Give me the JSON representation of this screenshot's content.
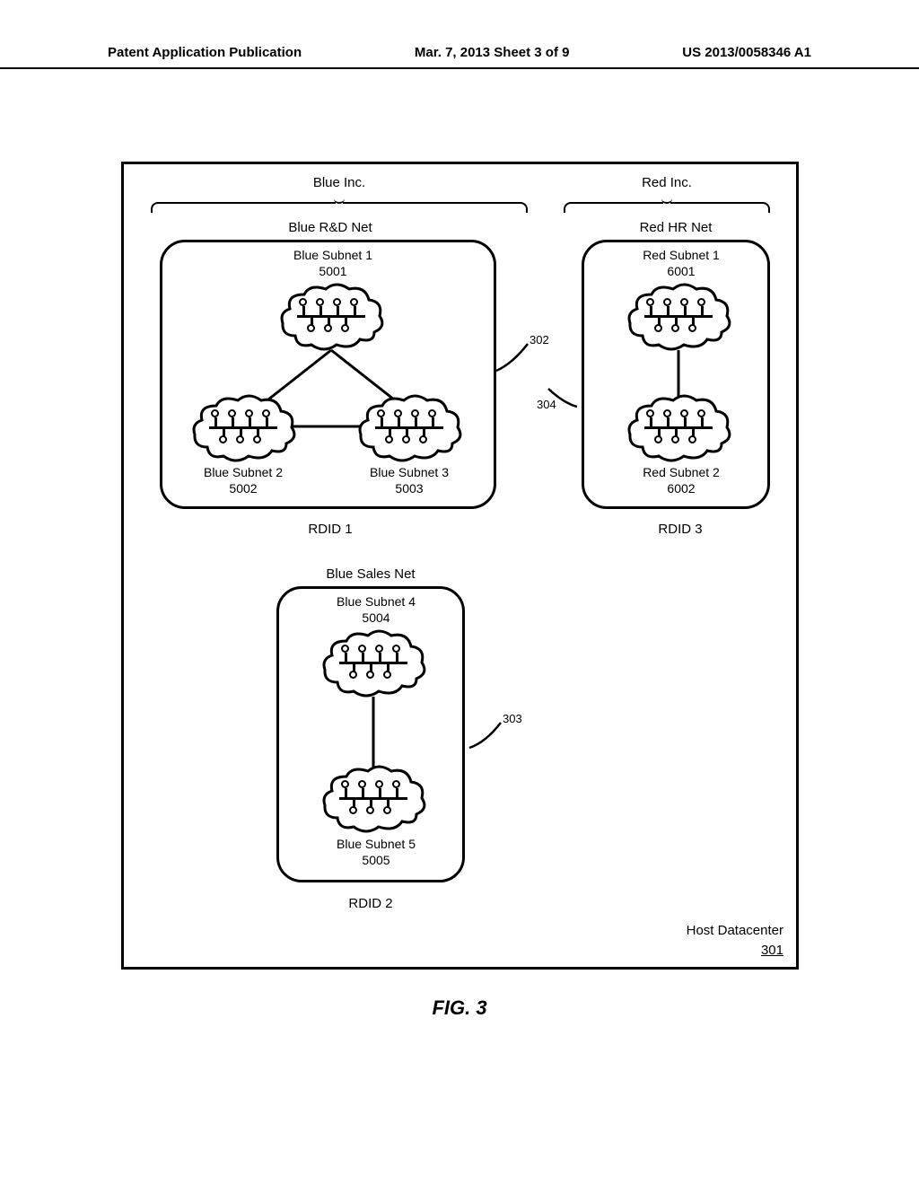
{
  "header": {
    "left": "Patent Application Publication",
    "center": "Mar. 7, 2013  Sheet 3 of 9",
    "right": "US 2013/0058346 A1"
  },
  "figure_caption": "FIG.  3",
  "companies": {
    "blue": "Blue Inc.",
    "red": "Red Inc."
  },
  "networks": {
    "blue_rnd": {
      "title": "Blue R&D Net",
      "rdid": "RDID 1",
      "subnets": {
        "s1": {
          "name": "Blue Subnet 1",
          "id": "5001"
        },
        "s2": {
          "name": "Blue Subnet 2",
          "id": "5002"
        },
        "s3": {
          "name": "Blue Subnet 3",
          "id": "5003"
        }
      }
    },
    "blue_sales": {
      "title": "Blue Sales Net",
      "rdid": "RDID 2",
      "subnets": {
        "s4": {
          "name": "Blue Subnet 4",
          "id": "5004"
        },
        "s5": {
          "name": "Blue Subnet 5",
          "id": "5005"
        }
      }
    },
    "red_hr": {
      "title": "Red HR Net",
      "rdid": "RDID 3",
      "subnets": {
        "r1": {
          "name": "Red Subnet 1",
          "id": "6001"
        },
        "r2": {
          "name": "Red Subnet 2",
          "id": "6002"
        }
      }
    }
  },
  "refs": {
    "r302": "302",
    "r303": "303",
    "r304": "304"
  },
  "host": {
    "label": "Host Datacenter",
    "num": "301"
  }
}
